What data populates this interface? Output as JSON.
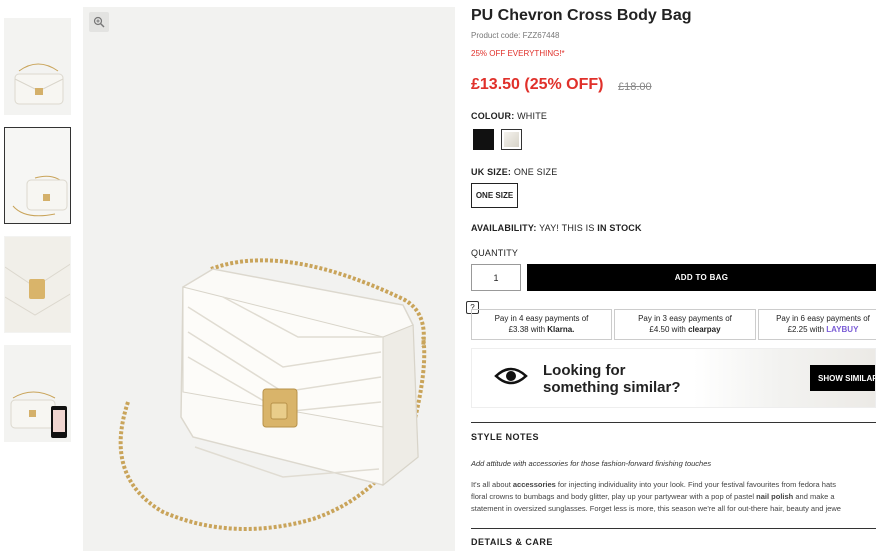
{
  "product": {
    "title": "PU Chevron Cross Body Bag",
    "code": "Product code: FZZ67448",
    "promo": "25% OFF EVERYTHING!*",
    "price": "£13.50 (25% OFF)",
    "was_price": "£18.00"
  },
  "colour": {
    "label": "COLOUR:",
    "value": "WHITE",
    "options": [
      "black",
      "white"
    ],
    "selected": "white"
  },
  "size": {
    "label": "UK SIZE:",
    "value": "ONE SIZE",
    "option": "ONE SIZE"
  },
  "availability": {
    "label": "AVAILABILITY:",
    "prefix": "YAY! THIS IS",
    "status": "IN STOCK"
  },
  "quantity": {
    "label": "QUANTITY",
    "value": "1"
  },
  "add_to_bag": "ADD TO BAG",
  "help_icon": "?",
  "payments": [
    {
      "line1": "Pay in 4 easy payments of",
      "amount": "£3.38 with",
      "brand": "Klarna."
    },
    {
      "line1": "Pay in 3 easy payments of",
      "amount": "£4.50 with",
      "brand": "clearpay"
    },
    {
      "line1": "Pay in 6 easy payments of",
      "amount": "£2.25 with",
      "brand": "LAYBUY"
    }
  ],
  "similar": {
    "line1": "Looking for",
    "line2": "something similar?",
    "button": "SHOW SIMILAR"
  },
  "style_notes": {
    "heading": "STYLE NOTES",
    "tagline": "Add attitude with accessories for those fashion-forward finishing touches",
    "p1_a": "It's all about ",
    "p1_b": "accessories",
    "p1_c": " for injecting individuality into your look. Find your festival favourites from fedora hats",
    "p2_a": "floral crowns to bumbags and body glitter, play up your partywear with a pop of pastel ",
    "p2_b": "nail polish",
    "p2_c": " and make a",
    "p3": "statement in oversized sunglasses. Forget less is more, this season we're all for out-there hair, beauty and jewe"
  },
  "details": {
    "heading": "DETAILS & CARE"
  },
  "colors": {
    "accent_red": "#e0302a",
    "black": "#000000",
    "gold": "#c9a45a"
  }
}
